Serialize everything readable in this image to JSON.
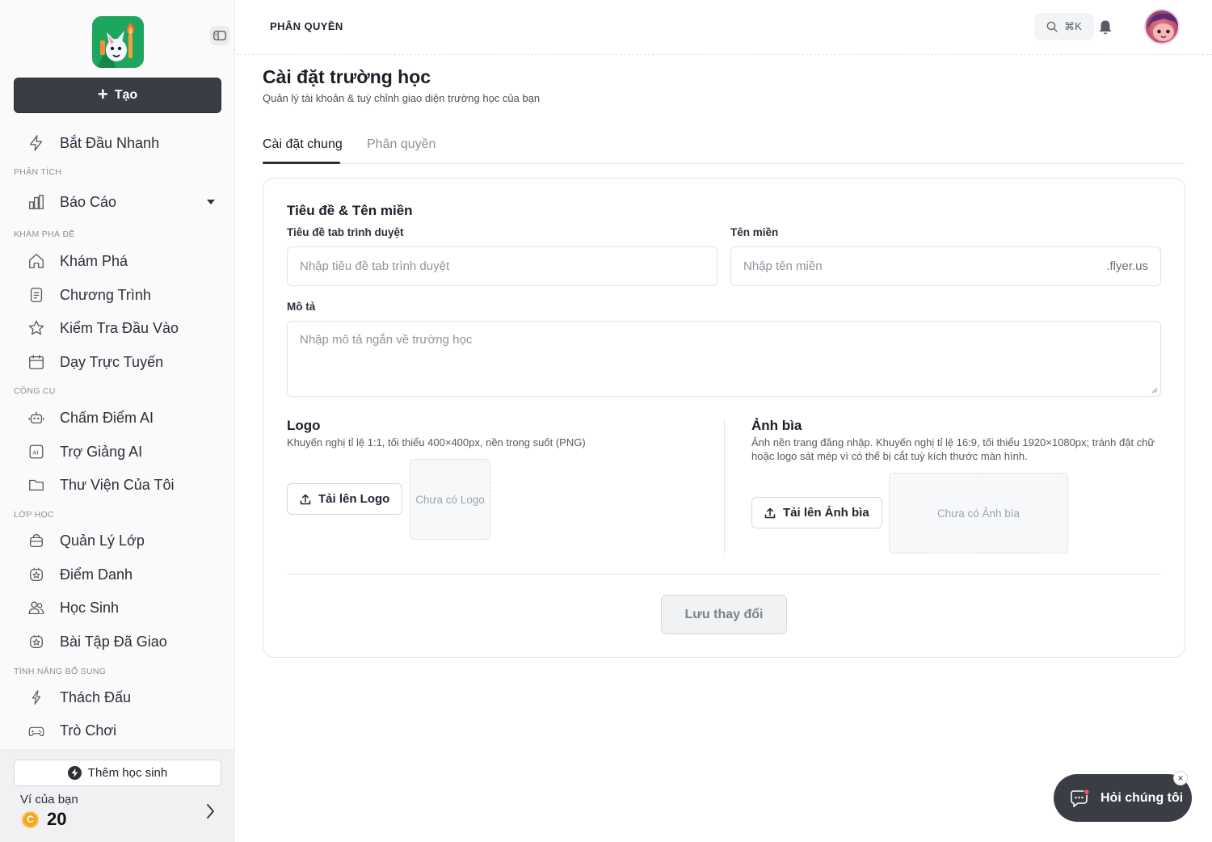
{
  "sidebar": {
    "create_label": "Tạo",
    "quick_start": "Bắt Đầu Nhanh",
    "sections": {
      "analytics": "PHÂN TÍCH",
      "explore": "KHÁM PHÁ ĐỀ",
      "tools": "CÔNG CỤ",
      "classes": "LỚP HỌC",
      "extras": "TÍNH NĂNG BỔ SUNG"
    },
    "items": {
      "reports": "Báo Cáo",
      "explore": "Khám Phá",
      "programs": "Chương Trình",
      "entrance_test": "Kiểm Tra Đầu Vào",
      "online_teaching": "Dạy Trực Tuyến",
      "ai_grading": "Chấm Điểm AI",
      "ai_assistant": "Trợ Giảng AI",
      "my_library": "Thư Viện Của Tôi",
      "class_manage": "Quản Lý Lớp",
      "attendance": "Điểm Danh",
      "students": "Học Sinh",
      "assigned_homework": "Bài Tập Đã Giao",
      "challenge": "Thách Đấu",
      "games": "Trò Chơi"
    },
    "add_student": "Thêm học sinh",
    "wallet_label": "Ví của bạn",
    "wallet_coin": "C",
    "wallet_amount": "20"
  },
  "header": {
    "breadcrumb": "PHÂN QUYỀN",
    "search_shortcut": "⌘K"
  },
  "page": {
    "title": "Cài đặt trường học",
    "subtitle": "Quản lý tài khoản & tuỳ chỉnh giao diện trường học của bạn",
    "tabs": [
      {
        "label": "Cài đặt chung",
        "active": true
      },
      {
        "label": "Phân quyền",
        "active": false
      }
    ]
  },
  "form": {
    "section_title": "Tiêu đề & Tên miền",
    "tab_title_label": "Tiêu đề tab trình duyệt",
    "tab_title_placeholder": "Nhập tiêu đề tab trình duyệt",
    "tab_title_value": "",
    "domain_label": "Tên miền",
    "domain_placeholder": "Nhập tên miền",
    "domain_value": "",
    "domain_suffix": ".flyer.us",
    "description_label": "Mô tả",
    "description_placeholder": "Nhập mô tả ngắn về trường học",
    "description_value": "",
    "logo": {
      "title": "Logo",
      "hint": "Khuyến nghị tỉ lệ 1:1, tối thiểu 400×400px, nền trong suốt (PNG)",
      "upload_label": "Tải lên Logo",
      "empty_text": "Chưa có Logo"
    },
    "cover": {
      "title": "Ảnh bìa",
      "hint": "Ảnh nền trang đăng nhập. Khuyến nghị tỉ lệ 16:9, tối thiểu 1920×1080px; tránh đặt chữ hoặc logo sát mép vì có thể bị cắt tuỳ kích thước màn hình.",
      "upload_label": "Tải lên Ảnh bìa",
      "empty_text": "Chưa có Ảnh bìa"
    },
    "save_label": "Lưu thay đổi"
  },
  "chat": {
    "label": "Hỏi chúng tôi",
    "close": "×"
  },
  "colors": {
    "primary_dark": "#3a3d44",
    "coin": "#f5a623",
    "logo_bg": "#1fa65e"
  }
}
